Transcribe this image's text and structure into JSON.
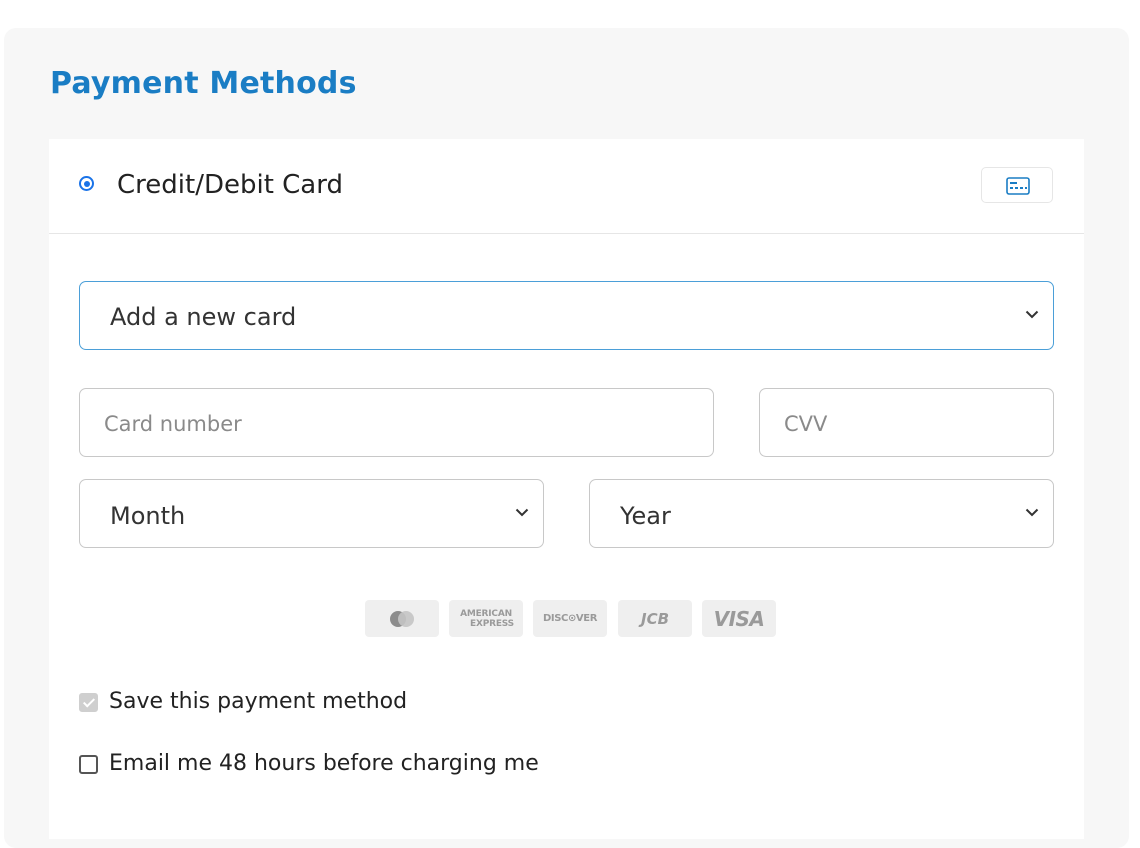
{
  "section": {
    "title": "Payment Methods"
  },
  "method": {
    "label": "Credit/Debit Card",
    "selected": true,
    "icon": "credit-card-icon"
  },
  "card_select": {
    "value": "Add a new card"
  },
  "inputs": {
    "card_number_placeholder": "Card number",
    "cvv_placeholder": "CVV"
  },
  "expiry": {
    "month_value": "Month",
    "year_value": "Year"
  },
  "brands": [
    {
      "name": "mastercard-logo"
    },
    {
      "name": "american-express-logo",
      "line1": "AMERICAN",
      "line2": "EXPRESS"
    },
    {
      "name": "discover-logo",
      "text": "DISC⊙VER"
    },
    {
      "name": "jcb-logo",
      "text": "JCB"
    },
    {
      "name": "visa-logo",
      "text": "VISA"
    }
  ],
  "options": {
    "save_label": "Save this payment method",
    "save_checked": true,
    "email_label": "Email me 48 hours before charging me",
    "email_checked": false
  },
  "colors": {
    "accent": "#1a7dc4",
    "radio": "#1a73e8",
    "panel_bg": "#f7f7f7",
    "brand_bg": "#efefef"
  }
}
